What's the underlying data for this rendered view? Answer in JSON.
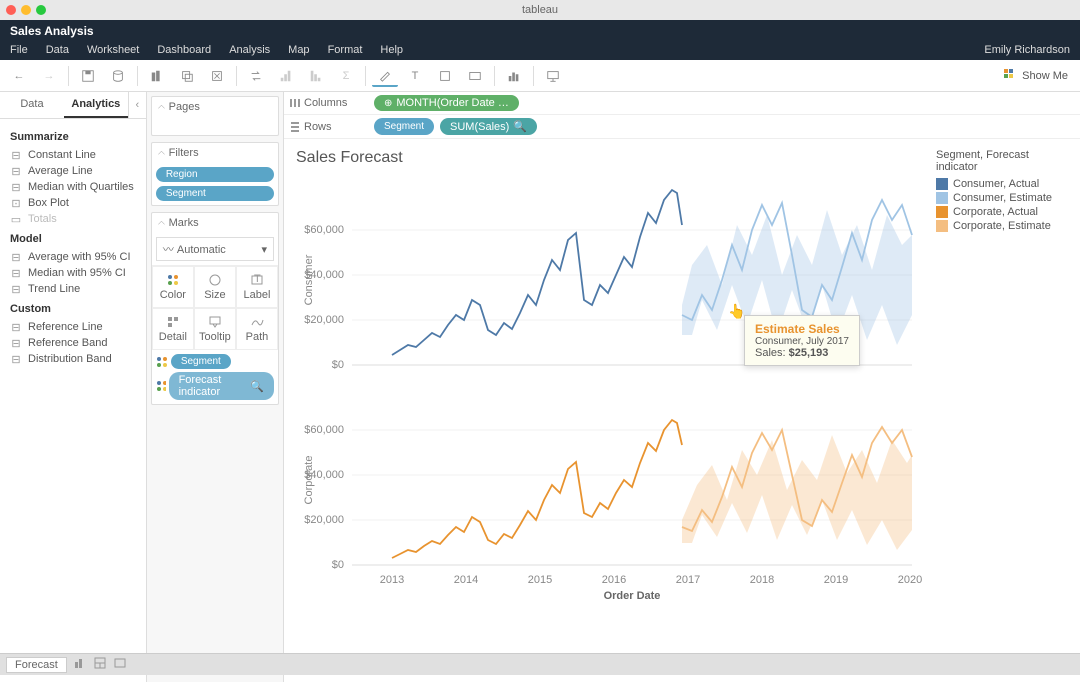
{
  "app": {
    "mac_title": "tableau",
    "title": "Sales Analysis",
    "user": "Emily Richardson"
  },
  "menu": [
    "File",
    "Data",
    "Worksheet",
    "Dashboard",
    "Analysis",
    "Map",
    "Format",
    "Help"
  ],
  "toolbar": {
    "show_me": "Show Me"
  },
  "sidepanel": {
    "tabs": {
      "data": "Data",
      "analytics": "Analytics"
    },
    "summarize_h": "Summarize",
    "summarize": [
      "Constant Line",
      "Average Line",
      "Median with Quartiles",
      "Box Plot",
      "Totals"
    ],
    "model_h": "Model",
    "model": [
      "Average with 95% CI",
      "Median with 95% CI",
      "Trend Line"
    ],
    "custom_h": "Custom",
    "custom": [
      "Reference Line",
      "Reference Band",
      "Distribution Band"
    ]
  },
  "mid": {
    "pages": "Pages",
    "filters": "Filters",
    "filter_pills": [
      "Region",
      "Segment"
    ],
    "marks": "Marks",
    "marks_type": "Automatic",
    "marks_cells": [
      "Color",
      "Size",
      "Label",
      "Detail",
      "Tooltip",
      "Path"
    ],
    "marks_pills": [
      "Segment",
      "Forecast indicator"
    ]
  },
  "shelves": {
    "columns": "Columns",
    "rows": "Rows",
    "col_pill": "MONTH(Order Date …",
    "row_pill1": "Segment",
    "row_pill2": "SUM(Sales)"
  },
  "viz": {
    "title": "Sales Forecast",
    "ylabels": [
      "$0",
      "$20,000",
      "$40,000",
      "$60,000"
    ],
    "xlabels": [
      "2013",
      "2014",
      "2015",
      "2016",
      "2017",
      "2018",
      "2019",
      "2020"
    ],
    "xaxis": "Order Date",
    "panel1": "Consumer",
    "panel2": "Corporate"
  },
  "legend": {
    "title": "Segment, Forecast indicator",
    "items": [
      {
        "label": "Consumer, Actual",
        "color": "#4e79a7"
      },
      {
        "label": "Consumer, Estimate",
        "color": "#a0c4e4"
      },
      {
        "label": "Corporate, Actual",
        "color": "#e8932f"
      },
      {
        "label": "Corporate, Estimate",
        "color": "#f4be81"
      }
    ]
  },
  "tooltip": {
    "title": "Estimate Sales",
    "line1": "Consumer, July 2017",
    "line2_label": "Sales: ",
    "line2_val": "$25,193"
  },
  "footer": {
    "sheet": "Forecast"
  },
  "chart_data": {
    "type": "line",
    "xaxis": "Order Date (monthly, 2012-01 → 2019-12)",
    "ylabel": "Sales",
    "ylim": [
      0,
      65000
    ],
    "panels": [
      "Consumer",
      "Corporate"
    ],
    "series": [
      {
        "name": "Consumer, Actual",
        "color": "#4e79a7",
        "panel": "Consumer",
        "x_range": "2012-01..2016-12",
        "values": [
          3000,
          4200,
          5500,
          4800,
          6100,
          7200,
          6500,
          8200,
          11500,
          9800,
          14000,
          12500,
          8500,
          7200,
          9500,
          8200,
          11500,
          14200,
          12500,
          17500,
          22000,
          19500,
          26000,
          28500,
          14000,
          12500,
          16500,
          15200,
          19500,
          23500,
          20800,
          28500,
          35000,
          31500,
          42000,
          47000,
          46000,
          41000,
          44000,
          38000,
          42000,
          48000,
          43000,
          52000,
          58000,
          54000,
          60000,
          52000,
          20000,
          22000,
          25000,
          38000,
          40000,
          48000,
          45000,
          42000,
          48000,
          44000,
          46000,
          48000
        ]
      },
      {
        "name": "Consumer, Estimate",
        "color": "#a0c4e4",
        "panel": "Consumer",
        "x_range": "2017-01..2019-12",
        "values": [
          22000,
          20000,
          28000,
          25193,
          32000,
          42000,
          35000,
          48000,
          56000,
          50000,
          58000,
          45000,
          25000,
          23000,
          30000,
          28000,
          35000,
          45000,
          38000,
          50000,
          58000,
          52000,
          58000,
          46000,
          27000,
          25000,
          32000,
          30000,
          37000,
          47000,
          40000,
          52000,
          60000,
          54000,
          58000,
          50000
        ]
      },
      {
        "name": "Corporate, Actual",
        "color": "#e8932f",
        "panel": "Corporate",
        "x_range": "2012-01..2016-12",
        "values": [
          2000,
          2800,
          3600,
          3200,
          4100,
          4800,
          4300,
          5500,
          7500,
          6500,
          9200,
          8300,
          5600,
          4800,
          6300,
          5400,
          7600,
          9400,
          8300,
          11500,
          14500,
          12900,
          17100,
          18800,
          9200,
          8200,
          10900,
          10000,
          12900,
          15500,
          13700,
          18800,
          23100,
          20800,
          27700,
          31000,
          30300,
          27000,
          29000,
          25000,
          27700,
          31600,
          28300,
          34300,
          38200,
          35600,
          39600,
          34300,
          13200,
          14500,
          16500,
          25000,
          26400,
          31600,
          29700,
          27700,
          31600,
          29000,
          30300,
          31600
        ]
      },
      {
        "name": "Corporate, Estimate",
        "color": "#f4be81",
        "panel": "Corporate",
        "x_range": "2017-01..2019-12",
        "values": [
          14500,
          13200,
          18500,
          16600,
          21100,
          27700,
          23100,
          31600,
          36900,
          33000,
          38200,
          29700,
          16500,
          15200,
          19800,
          18500,
          23100,
          29700,
          25000,
          33000,
          38200,
          34300,
          38200,
          30300,
          17800,
          16500,
          21100,
          19800,
          24400,
          31000,
          26400,
          34300,
          39600,
          35600,
          38200,
          33000
        ]
      }
    ],
    "forecast_band": "±30% around estimate series"
  }
}
